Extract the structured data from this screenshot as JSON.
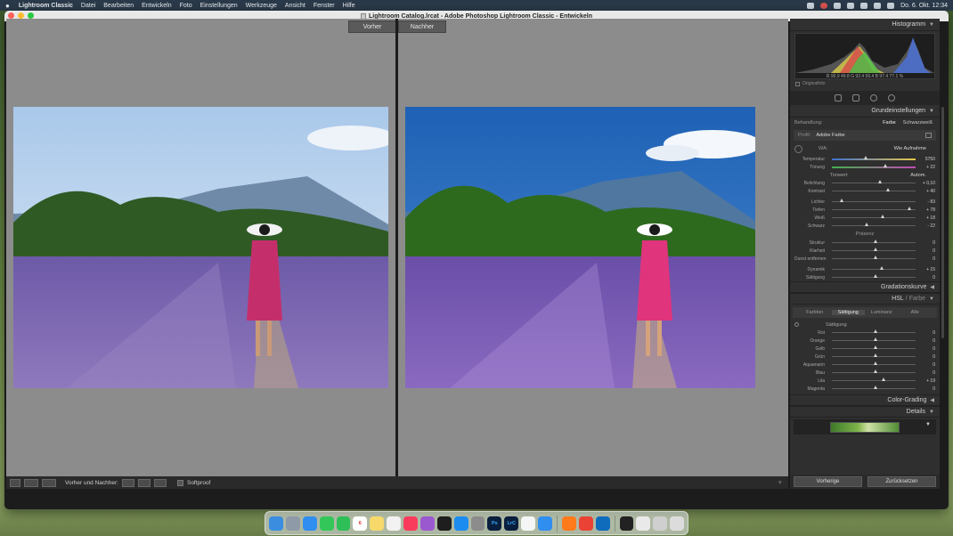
{
  "menubar": {
    "apple": "",
    "items": [
      "Lightroom Classic",
      "Datei",
      "Bearbeiten",
      "Entwickeln",
      "Foto",
      "Einstellungen",
      "Werkzeuge",
      "Ansicht",
      "Fenster",
      "Hilfe"
    ],
    "clock": "Do. 6. Okt.  12:34"
  },
  "window": {
    "title": "Lightroom Catalog.lrcat - Adobe Photoshop Lightroom Classic - Entwickeln"
  },
  "compare": {
    "before_label": "Vorher",
    "after_label": "Nachher"
  },
  "toolbar": {
    "view_label": "Vorher und Nachher:",
    "softproof_label": "Softproof"
  },
  "histogram": {
    "title": "Histogramm",
    "readout": "R  90.9  49.8  G  92.4  56.4  B  97.4  77.1  %",
    "original_photo_label": "Originalfoto"
  },
  "basic": {
    "title": "Grundeinstellungen",
    "treatment_label": "Behandlung:",
    "treatment_color": "Farbe",
    "treatment_bw": "Schwarzweiß",
    "profile_label": "Profil:",
    "profile_value": "Adobe Farbe",
    "wb_label": "WA:",
    "wb_value": "Wie Aufnahme",
    "temp": {
      "name": "Temperatur",
      "value": "5750"
    },
    "tint": {
      "name": "Tönung",
      "value": "+ 22"
    },
    "tone_label": "Tonwert",
    "auto_label": "Autom.",
    "tone_sliders": [
      {
        "name": "Belichtung",
        "value": "+ 0,10",
        "pos": 0.55
      },
      {
        "name": "Kontrast",
        "value": "+ 40",
        "pos": 0.65
      }
    ],
    "tone_sliders2": [
      {
        "name": "Lichter",
        "value": "- 83",
        "pos": 0.1
      },
      {
        "name": "Tiefen",
        "value": "+ 78",
        "pos": 0.9
      },
      {
        "name": "Weiß",
        "value": "+ 18",
        "pos": 0.58
      },
      {
        "name": "Schwarz",
        "value": "- 22",
        "pos": 0.39
      }
    ],
    "presence_label": "Präsenz",
    "presence_sliders": [
      {
        "name": "Struktur",
        "value": "0",
        "pos": 0.5
      },
      {
        "name": "Klarheit",
        "value": "0",
        "pos": 0.5
      },
      {
        "name": "Dunst entfernen",
        "value": "0",
        "pos": 0.5
      }
    ],
    "presence_sliders2": [
      {
        "name": "Dynamik",
        "value": "+ 15",
        "pos": 0.57
      },
      {
        "name": "Sättigung",
        "value": "0",
        "pos": 0.5
      }
    ]
  },
  "sections": {
    "tone_curve": "Gradationskurve",
    "hsl": "HSL",
    "hsl_color": "Farbe",
    "color_grading": "Color-Grading",
    "details": "Details"
  },
  "hsl_tabs": [
    "Farbton",
    "Sättigung",
    "Luminanz",
    "Alle"
  ],
  "hsl_title": "Sättigung",
  "hsl_sliders": [
    {
      "name": "Rot",
      "value": "0",
      "pos": 0.5
    },
    {
      "name": "Orange",
      "value": "0",
      "pos": 0.5
    },
    {
      "name": "Gelb",
      "value": "0",
      "pos": 0.5
    },
    {
      "name": "Grün",
      "value": "0",
      "pos": 0.5
    },
    {
      "name": "Aquamarin",
      "value": "0",
      "pos": 0.5
    },
    {
      "name": "Blau",
      "value": "0",
      "pos": 0.5
    },
    {
      "name": "Lila",
      "value": "+ 19",
      "pos": 0.6
    },
    {
      "name": "Magenta",
      "value": "0",
      "pos": 0.5
    }
  ],
  "panel_buttons": {
    "previous": "Vorherige",
    "reset": "Zurücksetzen"
  },
  "colors": {
    "sky_before": "#c8dbee",
    "sky_after": "#2f6fb8",
    "lavender": "#7a5fb0",
    "dress": "#c8306f"
  },
  "dock": [
    "finder-icon",
    "launchpad-icon",
    "safari-icon",
    "messages-icon",
    "facetime-icon",
    "calendar-icon",
    "notes-icon",
    "reminders-icon",
    "music-icon",
    "podcasts-icon",
    "tv-icon",
    "app-store-icon",
    "settings-icon",
    "photoshop-icon",
    "lightroom-classic-icon",
    "photos-icon",
    "mail-icon",
    "firefox-icon",
    "chrome-icon",
    "outlook-icon",
    "terminal-icon",
    "preview-icon",
    "folder-icon",
    "trash-icon"
  ],
  "dock_labels": {
    "calendar": "6",
    "photoshop": "Ps",
    "lightroom": "LrC"
  }
}
